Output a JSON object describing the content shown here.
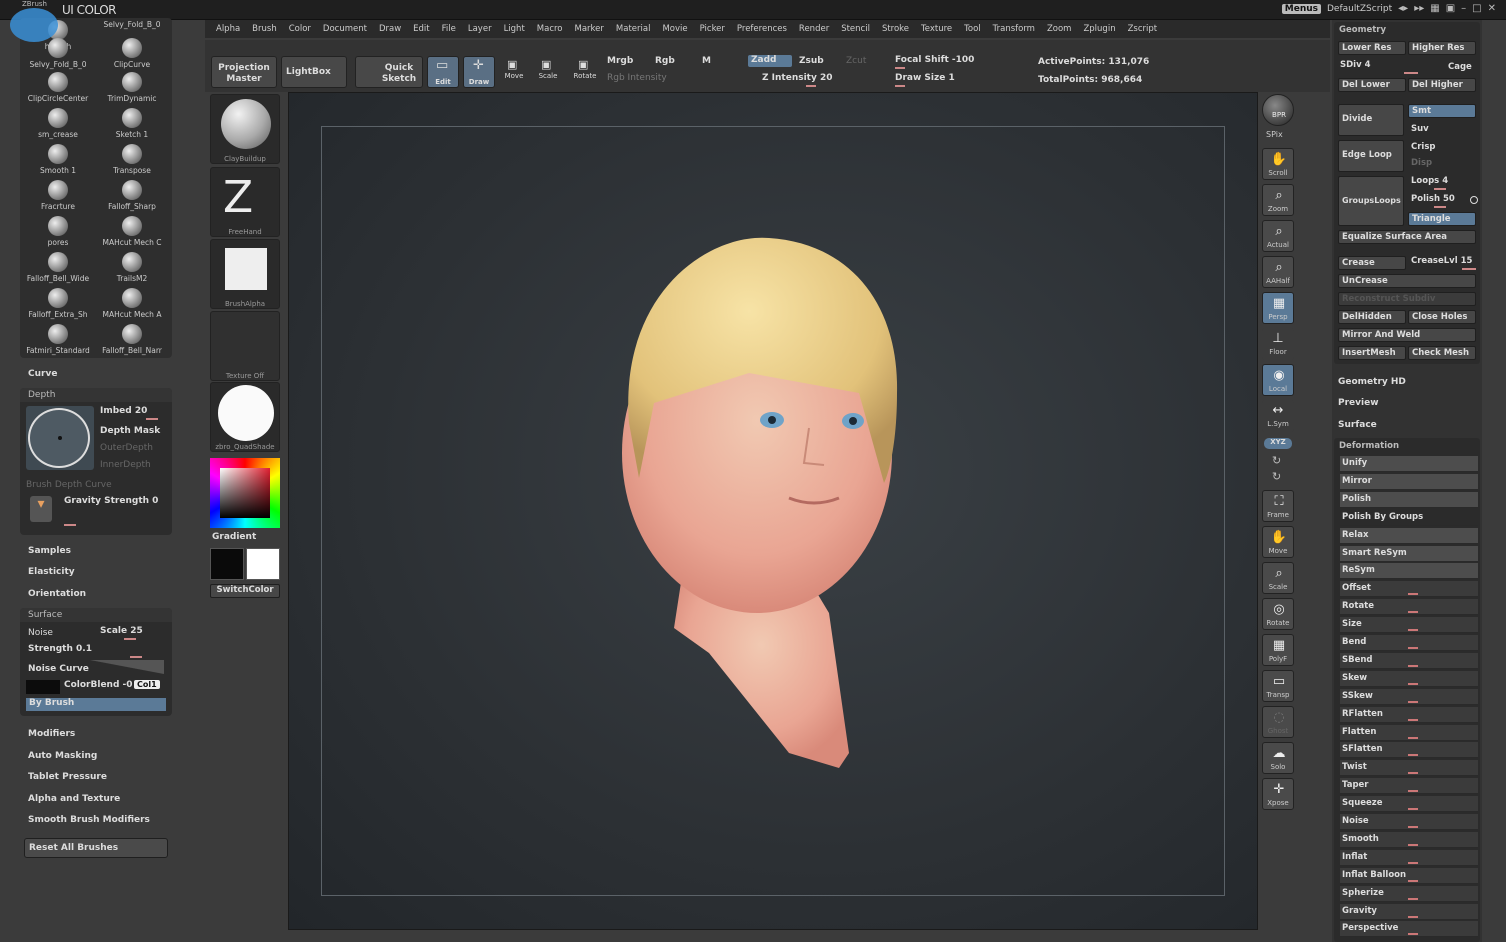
{
  "app": {
    "logo_small": "ZBrush",
    "logo_big": "UI COLOR"
  },
  "topbar": {
    "menus_label": "Menus",
    "script_label": "DefaultZScript"
  },
  "menubar": [
    "Alpha",
    "Brush",
    "Color",
    "Document",
    "Draw",
    "Edit",
    "File",
    "Layer",
    "Light",
    "Macro",
    "Marker",
    "Material",
    "Movie",
    "Picker",
    "Preferences",
    "Render",
    "Stencil",
    "Stroke",
    "Texture",
    "Tool",
    "Transform",
    "Zoom",
    "Zplugin",
    "Zscript"
  ],
  "shelf": {
    "projection_master": "Projection Master",
    "lightbox": "LightBox",
    "quick_sketch": "Quick Sketch",
    "edit": "Edit",
    "draw": "Draw",
    "move": "Move",
    "scale": "Scale",
    "rotate": "Rotate",
    "mrgb": "Mrgb",
    "rgb": "Rgb",
    "m": "M",
    "rgb_intensity": "Rgb Intensity",
    "zadd": "Zadd",
    "zsub": "Zsub",
    "zcut": "Zcut",
    "z_intensity": "Z Intensity 20",
    "focal_shift": "Focal Shift -100",
    "draw_size": "Draw Size 1",
    "active_points": "ActivePoints: 131,076",
    "total_points": "TotalPoints: 968,664"
  },
  "brushes": [
    [
      "hPolish",
      "Selvy_Fold_B_0"
    ],
    [
      "Selvy_Fold_B_0",
      "ClipCurve"
    ],
    [
      "ClipCircleCenter",
      "TrimDynamic"
    ],
    [
      "sm_crease",
      "Sketch 1"
    ],
    [
      "Smooth 1",
      "Transpose"
    ],
    [
      "Fracrture",
      "Falloff_Sharp"
    ],
    [
      "pores",
      "MAHcut Mech C"
    ],
    [
      "Falloff_Bell_Wide",
      "TrailsM2"
    ],
    [
      "Falloff_Extra_Sh",
      "MAHcut Mech A"
    ],
    [
      "Fatmiri_Standard",
      "Falloff_Bell_Narr"
    ]
  ],
  "left": {
    "curve": "Curve",
    "depth_head": "Depth",
    "imbed": "Imbed 20",
    "depth_mask": "Depth Mask",
    "outer_depth": "OuterDepth",
    "inner_depth": "InnerDepth",
    "brush_depth_curve": "Brush Depth Curve",
    "gravity_strength": "Gravity Strength 0",
    "samples": "Samples",
    "elasticity": "Elasticity",
    "orientation": "Orientation",
    "surface_head": "Surface",
    "noise": "Noise",
    "scale": "Scale 25",
    "strength": "Strength 0.1",
    "noise_curve": "Noise Curve",
    "color_blend": "ColorBlend -0",
    "col1": "Col1",
    "by_brush": "By Brush",
    "modifiers": "Modifiers",
    "auto_masking": "Auto Masking",
    "tablet_pressure": "Tablet Pressure",
    "alpha_texture": "Alpha and Texture",
    "smooth_brush_modifiers": "Smooth Brush Modifiers",
    "reset_all": "Reset All Brushes"
  },
  "toolcol": {
    "clay": "ClayBuildup",
    "freehand": "FreeHand",
    "brushalpha": "BrushAlpha",
    "texture": "Texture Off",
    "material": "zbro_QuadShade",
    "gradient": "Gradient",
    "switchcolor": "SwitchColor"
  },
  "strip": [
    "SPix",
    "Scroll",
    "Zoom",
    "Actual",
    "AAHalf",
    "Persp",
    "Floor",
    "Local",
    "L.Sym",
    "Frame",
    "Move",
    "Scale",
    "Rotate",
    "PolyF",
    "Transp",
    "Ghost",
    "Solo",
    "Xpose"
  ],
  "strip_xyz": "XYZ",
  "strip_bpr": "BPR",
  "right": {
    "geometry": "Geometry",
    "lower_res": "Lower Res",
    "higher_res": "Higher Res",
    "sdiv": "SDiv 4",
    "cage": "Cage",
    "del_lower": "Del Lower",
    "del_higher": "Del Higher",
    "divide": "Divide",
    "smt": "Smt",
    "suv": "Suv",
    "edge_loop": "Edge Loop",
    "crisp": "Crisp",
    "disp": "Disp",
    "groups_loops": "GroupsLoops",
    "loops": "Loops 4",
    "polish": "Polish 50",
    "triangle": "Triangle",
    "equalize": "Equalize Surface Area",
    "crease": "Crease",
    "crease_lvl": "CreaseLvl 15",
    "uncrease": "UnCrease",
    "reconstruct": "Reconstruct Subdiv",
    "delhidden": "DelHidden",
    "close_holes": "Close Holes",
    "mirror_weld": "Mirror And Weld",
    "insert_mesh": "InsertMesh",
    "check_mesh": "Check Mesh",
    "geometry_hd": "Geometry HD",
    "preview": "Preview",
    "surface": "Surface",
    "deformation": "Deformation",
    "deform_items": [
      "Unify",
      "Mirror",
      "Polish",
      "Polish By Groups",
      "Relax",
      "Smart ReSym",
      "ReSym",
      "Offset",
      "Rotate",
      "Size",
      "Bend",
      "SBend",
      "Skew",
      "SSkew",
      "RFlatten",
      "Flatten",
      "SFlatten",
      "Twist",
      "Taper",
      "Squeeze",
      "Noise",
      "Smooth",
      "Inflat",
      "Inflat Balloon",
      "Spherize",
      "Gravity",
      "Perspective"
    ]
  },
  "colors": {
    "accent_blue": "#5b7a97",
    "slider_red": "#c77777"
  }
}
